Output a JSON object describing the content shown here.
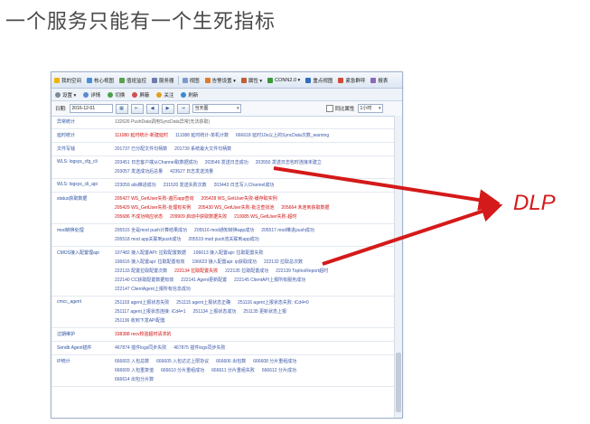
{
  "slide_title": "一个服务只能有一个生死指标",
  "annotation_label": "DLP",
  "toolbar1": [
    "我的空间",
    "核心视图",
    "值班监控",
    "服务器",
    "视图",
    "告警设置 ▾",
    "属性 ▾",
    "CONN2.0 ▾",
    "重点视图",
    "紧急群呼",
    "报表"
  ],
  "toolbar2": [
    "设置 ▾",
    "详情",
    "切换",
    "屏蔽",
    "关注",
    "刷新"
  ],
  "filter": {
    "date_label": "日期:",
    "date_value": "2016-12-01",
    "range_value": "当天图",
    "checkbox_label": "同比属性",
    "interval_value": "1小时"
  },
  "rows": [
    {
      "label": "异常统计",
      "lines": [
        [
          {
            "t": "132626 PushData调用SyncData异常(无法获取)",
            "c": "gray"
          }
        ]
      ]
    },
    {
      "label": "延时统计",
      "lines": [
        [
          {
            "t": "111080 延时统计-新建延时",
            "c": "red"
          },
          {
            "t": "111088 延时统计-单机计数",
            "c": "blue"
          },
          {
            "t": "666618 延时10s以上的SyncData次数_warning",
            "c": "blue"
          }
        ]
      ]
    },
    {
      "label": "文件写钱",
      "lines": [
        [
          {
            "t": "201737 已分配文件句柄数",
            "c": "blue"
          },
          {
            "t": "201739 系统最大文件句柄数",
            "c": "blue"
          }
        ]
      ]
    },
    {
      "label": "WLS: logsys_cfg_cli",
      "lines": [
        [
          {
            "t": "203451 日志客户端从Channel取数据成功",
            "c": "blue"
          },
          {
            "t": "203549 发送日志成功",
            "c": "blue"
          },
          {
            "t": "203550 发送日志包时连接未建立",
            "c": "blue"
          }
        ],
        [
          {
            "t": "203057 发送成功后总量",
            "c": "blue"
          },
          {
            "t": "423627 日志发送流量",
            "c": "blue"
          }
        ]
      ]
    },
    {
      "label": "WLS: logsys_cli_api",
      "lines": [
        [
          {
            "t": "223059 alis推进成功",
            "c": "blue"
          },
          {
            "t": "231520 发送失败次数",
            "c": "blue"
          },
          {
            "t": "203443 日志写入Channel成功",
            "c": "blue"
          }
        ]
      ]
    },
    {
      "label": "status获取数据",
      "lines": [
        [
          {
            "t": "205427 WS_GetUser失败-遍历app查询",
            "c": "red"
          },
          {
            "t": "205428 WS_GetUser失败-缓存取实例",
            "c": "red"
          }
        ],
        [
          {
            "t": "205429 WS_GetUser失败-处理有实例",
            "c": "red"
          },
          {
            "t": "205430 WS_GetUser失败-批注查找池",
            "c": "red"
          },
          {
            "t": "205664 未连到获取数据",
            "c": "red"
          }
        ],
        [
          {
            "t": "205686 不成功响应状态",
            "c": "red"
          },
          {
            "t": "209909 启动中获取数据失败",
            "c": "red"
          },
          {
            "t": "210085 WS_GetUser失败-超时",
            "c": "red"
          }
        ]
      ]
    },
    {
      "label": "mod转换处理",
      "lines": [
        [
          {
            "t": "205515 全是mod push计算结果成功",
            "c": "blue"
          },
          {
            "t": "205516 mod通知转换app成功",
            "c": "blue"
          },
          {
            "t": "205517 mod推进push成功",
            "c": "blue"
          }
        ],
        [
          {
            "t": "205518 mod app关联到push成功",
            "c": "blue"
          },
          {
            "t": "205519 mod push流关联到app成功",
            "c": "blue"
          }
        ]
      ]
    },
    {
      "label": "CMOS接入配置理api",
      "lines": [
        [
          {
            "t": "107482 接入配置API: 拉取配置数据",
            "c": "blue"
          },
          {
            "t": "196613 接入配置api: 拉取配置失败",
            "c": "blue"
          }
        ],
        [
          {
            "t": "196616 接入配置api: 拉取配置有效",
            "c": "blue"
          },
          {
            "t": "196623 接入配置api: ip获取成功",
            "c": "blue"
          },
          {
            "t": "222132 拉取总次数",
            "c": "blue"
          }
        ],
        [
          {
            "t": "222133 配置拉取配置次数",
            "c": "blue"
          },
          {
            "t": "222134 拉取配置失败",
            "c": "red"
          },
          {
            "t": "222135 拉取配置成功",
            "c": "blue"
          },
          {
            "t": "222139 TopInoReport超时",
            "c": "blue"
          }
        ],
        [
          {
            "t": "222140 CC获取配置数据有效",
            "c": "blue"
          },
          {
            "t": "222141 Agent更新配置",
            "c": "blue"
          },
          {
            "t": "222145 ClientAPI上报所有服务成功",
            "c": "blue"
          }
        ],
        [
          {
            "t": "222147 ClientAgent上报所有信息成功",
            "c": "blue"
          }
        ]
      ]
    },
    {
      "label": "cmcc_agent",
      "lines": [
        [
          {
            "t": "251103 agent上报状态失败",
            "c": "blue"
          },
          {
            "t": "251115 agent上报状态正确",
            "c": "blue"
          },
          {
            "t": "251116 agent上报状态失败: iCd4=0",
            "c": "blue"
          }
        ],
        [
          {
            "t": "251117 agent上报状态连接: iCd4=1",
            "c": "blue"
          },
          {
            "t": "251134 上报状态成功",
            "c": "blue"
          },
          {
            "t": "251135 更新状态上报",
            "c": "blue"
          }
        ],
        [
          {
            "t": "251136 收到下发API配置",
            "c": "blue"
          }
        ]
      ]
    },
    {
      "label": "过期维护",
      "lines": [
        [
          {
            "t": "338388 recv校验超时请求的",
            "c": "red"
          }
        ]
      ]
    },
    {
      "label": "Sendb Agent插件",
      "lines": [
        [
          {
            "t": "467874 插件logs同步失败",
            "c": "blue"
          },
          {
            "t": "467875 插件logs同步失败",
            "c": "blue"
          }
        ]
      ]
    },
    {
      "label": "IP统计",
      "lines": [
        [
          {
            "t": "666603 入包总数",
            "c": "blue"
          },
          {
            "t": "666605 入包达达上限协议",
            "c": "blue"
          },
          {
            "t": "666606 出包数",
            "c": "blue"
          },
          {
            "t": "666608 分片重组成功",
            "c": "blue"
          }
        ],
        [
          {
            "t": "666609 入包重复值",
            "c": "blue"
          },
          {
            "t": "666610 分片重组成功",
            "c": "blue"
          },
          {
            "t": "666611 分片重组失败",
            "c": "blue"
          },
          {
            "t": "666612 分片成功",
            "c": "blue"
          }
        ],
        [
          {
            "t": "666614 出包分片数",
            "c": "blue"
          }
        ]
      ]
    }
  ]
}
